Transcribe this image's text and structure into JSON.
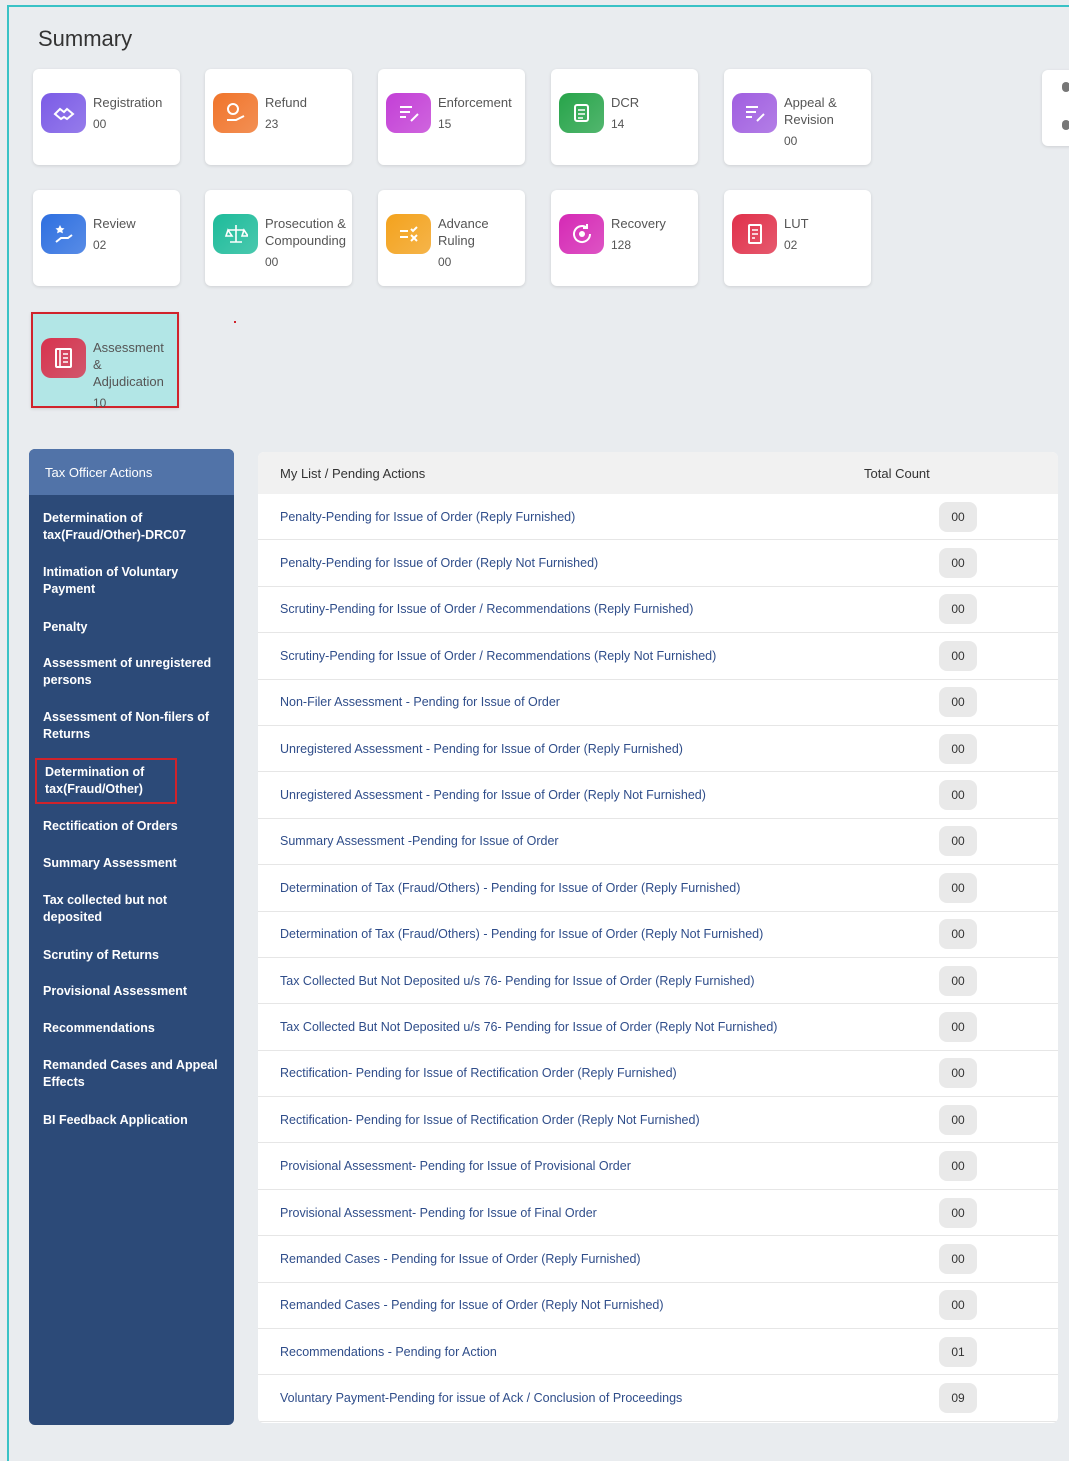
{
  "summary": {
    "title": "Summary",
    "tiles": [
      {
        "label": "Registration",
        "count": "00",
        "icon": "handshake-icon",
        "color": "#7b5be6"
      },
      {
        "label": "Refund",
        "count": "23",
        "icon": "rupee-hand-icon",
        "color": "#f0742a"
      },
      {
        "label": "Enforcement",
        "count": "15",
        "icon": "edit-list-icon",
        "color": "#c33fd6"
      },
      {
        "label": "DCR",
        "count": "14",
        "icon": "document-icon",
        "color": "#27a44a"
      },
      {
        "label": "Appeal & Revision",
        "count": "00",
        "icon": "edit-list-icon",
        "color": "#a05ee0"
      },
      {
        "label": "Review",
        "count": "02",
        "icon": "star-hand-icon",
        "color": "#2e6fe0"
      },
      {
        "label": "Prosecution & Compounding",
        "count": "00",
        "icon": "scales-icon",
        "color": "#1dbb9a"
      },
      {
        "label": "Advance Ruling",
        "count": "00",
        "icon": "check-cross-icon",
        "color": "#f3a21d"
      },
      {
        "label": "Recovery",
        "count": "128",
        "icon": "recovery-icon",
        "color": "#d529b5"
      },
      {
        "label": "LUT",
        "count": "02",
        "icon": "receipt-icon",
        "color": "#e0304a"
      },
      {
        "label": "Assessment & Adjudication",
        "count": "10",
        "icon": "ledger-icon",
        "color": "#d8334e"
      }
    ]
  },
  "sidebar": {
    "header": "Tax Officer Actions",
    "items": [
      "Determination of tax(Fraud/Other)-DRC07",
      "Intimation of Voluntary Payment",
      "Penalty",
      "Assessment of unregistered persons",
      "Assessment of Non-filers of Returns",
      "Determination of tax(Fraud/Other)",
      "Rectification of Orders",
      "Summary Assessment",
      "Tax collected but not deposited",
      "Scrutiny of Returns",
      "Provisional Assessment",
      "Recommendations",
      "Remanded Cases and Appeal Effects",
      "BI Feedback Application"
    ]
  },
  "pending": {
    "col_action": "My List / Pending Actions",
    "col_count": "Total Count",
    "rows": [
      {
        "label": "Penalty-Pending for Issue of Order (Reply Furnished)",
        "count": "00"
      },
      {
        "label": "Penalty-Pending for Issue of Order (Reply Not Furnished)",
        "count": "00"
      },
      {
        "label": "Scrutiny-Pending for Issue of Order / Recommendations (Reply Furnished)",
        "count": "00"
      },
      {
        "label": "Scrutiny-Pending for Issue of Order / Recommendations (Reply Not Furnished)",
        "count": "00"
      },
      {
        "label": "Non-Filer Assessment - Pending for Issue of Order",
        "count": "00"
      },
      {
        "label": "Unregistered Assessment - Pending for Issue of Order (Reply Furnished)",
        "count": "00"
      },
      {
        "label": "Unregistered Assessment - Pending for Issue of Order (Reply Not Furnished)",
        "count": "00"
      },
      {
        "label": "Summary Assessment -Pending for Issue of Order",
        "count": "00"
      },
      {
        "label": "Determination of Tax (Fraud/Others) - Pending for Issue of Order (Reply Furnished)",
        "count": "00"
      },
      {
        "label": "Determination of Tax (Fraud/Others) - Pending for Issue of Order (Reply Not Furnished)",
        "count": "00"
      },
      {
        "label": "Tax Collected But Not Deposited u/s 76- Pending for Issue of Order (Reply Furnished)",
        "count": "00"
      },
      {
        "label": "Tax Collected But Not Deposited u/s 76- Pending for Issue of Order (Reply Not Furnished)",
        "count": "00"
      },
      {
        "label": "Rectification- Pending for Issue of Rectification Order (Reply Furnished)",
        "count": "00"
      },
      {
        "label": "Rectification- Pending for Issue of Rectification Order (Reply Not Furnished)",
        "count": "00"
      },
      {
        "label": "Provisional Assessment- Pending for Issue of Provisional Order",
        "count": "00"
      },
      {
        "label": "Provisional Assessment- Pending for Issue of Final Order",
        "count": "00"
      },
      {
        "label": "Remanded Cases - Pending for Issue of Order (Reply Furnished)",
        "count": "00"
      },
      {
        "label": "Remanded Cases - Pending for Issue of Order (Reply Not Furnished)",
        "count": "00"
      },
      {
        "label": "Recommendations - Pending for Action",
        "count": "01"
      },
      {
        "label": "Voluntary Payment-Pending for issue of Ack / Conclusion of Proceedings",
        "count": "09"
      }
    ]
  }
}
